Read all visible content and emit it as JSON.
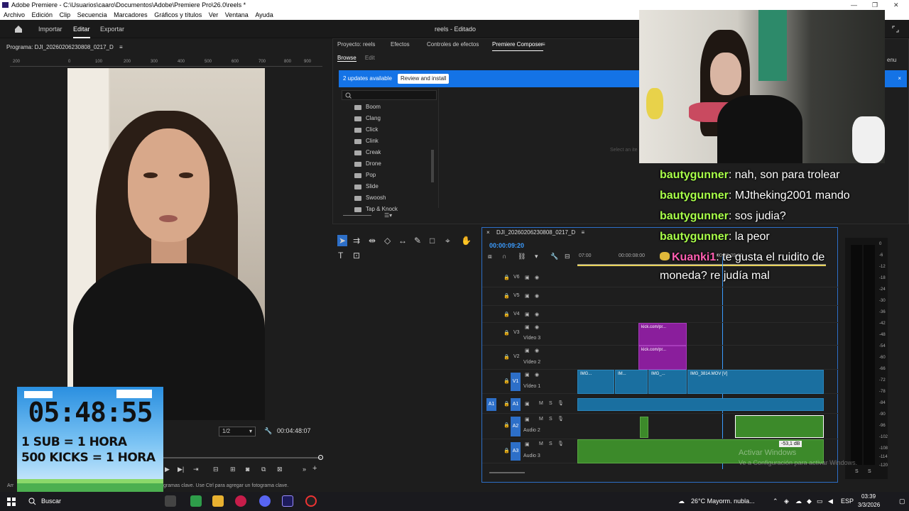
{
  "window": {
    "title": "Adobe Premiere - C:\\Usuarios\\caaro\\Documentos\\Adobe\\Premiere Pro\\26.0\\reels *",
    "minimize": "—",
    "maximize": "❐",
    "close": "✕"
  },
  "menu": [
    "Archivo",
    "Edición",
    "Clip",
    "Secuencia",
    "Marcadores",
    "Gráficos y títulos",
    "Ver",
    "Ventana",
    "Ayuda"
  ],
  "workspace": {
    "tabs": [
      "Importar",
      "Editar",
      "Exportar"
    ],
    "active": "Editar",
    "project_title": "reels - Editado"
  },
  "program_monitor": {
    "title": "Programa: DJI_20260206230808_0217_D",
    "ruler_ticks": [
      "200",
      "0",
      "100",
      "200",
      "300",
      "400",
      "500",
      "600",
      "700",
      "800",
      "900",
      "1000",
      "1100"
    ],
    "resolution": "1/2",
    "timecode": "00:04:48:07",
    "status": "gramas clave. Use Ctrl para agregar un fotograma clave.",
    "status_prefix": "Arr"
  },
  "overlay_timer": {
    "clock": "05:48:55",
    "line1": "1 SUB = 1 HORA",
    "line2": "500 KICKS = 1 HORA"
  },
  "effects_panel": {
    "tabs": [
      "Proyecto: reels",
      "Efectos",
      "Controles de efectos",
      "Premiere Composer"
    ],
    "subtabs": [
      "Browse",
      "Edit"
    ],
    "update_text": "2 updates available",
    "update_button": "Review and install",
    "menu_label": "enu",
    "placeholder": "Select an ite",
    "folders": [
      "Boom",
      "Clang",
      "Click",
      "Clink",
      "Creak",
      "Drone",
      "Pop",
      "Slide",
      "Swoosh",
      "Tap & Knock"
    ]
  },
  "timeline": {
    "sequence_name": "DJI_20260206230808_0217_D",
    "timecode": "00:00:09:20",
    "ruler": [
      "07:00",
      "00:00:08:00",
      "00:00:09:00"
    ],
    "tracks": [
      {
        "id": "V6",
        "name": ""
      },
      {
        "id": "V5",
        "name": ""
      },
      {
        "id": "V4",
        "name": ""
      },
      {
        "id": "V3",
        "name": "Vídeo 3"
      },
      {
        "id": "V2",
        "name": "Vídeo 2"
      },
      {
        "id": "V1",
        "name": "Vídeo 1"
      },
      {
        "id": "A1",
        "name": ""
      },
      {
        "id": "A2",
        "name": "Audio 2"
      },
      {
        "id": "A3",
        "name": "Audio 3"
      }
    ],
    "source_patch": "A1",
    "clips": {
      "v3": "kick.com/pr...",
      "v2": "kick.com/pr...",
      "v1_a": "IMG...",
      "v1_b": "IM...",
      "v1_c": "IMG_...",
      "v1_d": "IMG_3814.MOV [V]"
    },
    "db_tooltip": "-53,1 dB",
    "fx": "fx"
  },
  "meter_scale": [
    "0",
    "-6",
    "-12",
    "-18",
    "-24",
    "-30",
    "-36",
    "-42",
    "-48",
    "-54",
    "-60",
    "-66",
    "-72",
    "-78",
    "-84",
    "-90",
    "-96",
    "-102",
    "-108",
    "-114",
    "-120"
  ],
  "meter_bottom": [
    "S",
    "S"
  ],
  "chat": [
    {
      "user": "bautygunner",
      "msg": "nah, son para trolear"
    },
    {
      "user": "bautygunner",
      "msg": "MJtheking2001 mando"
    },
    {
      "user": "bautygunner",
      "msg": "sos judia?"
    },
    {
      "user": "bautygunner",
      "msg": "la peor"
    },
    {
      "user": "Kuanki1",
      "msg": "te gusta el ruidito de"
    },
    {
      "user": "",
      "msg": "moneda? re judía mal"
    }
  ],
  "watermark": {
    "line1": "Activar Windows",
    "line2": "Ve a Configuración para activar Windows."
  },
  "taskbar": {
    "search": "Buscar",
    "weather": "26°C  Mayorm. nubla...",
    "lang": "ESP",
    "time": "03:39",
    "date": "3/3/2026"
  },
  "colors": {
    "accent_blue": "#1473e6",
    "timecode_blue": "#3b9cff",
    "chat_user": "#a9ff4a",
    "chat_user_alt": "#ff5fb1"
  }
}
